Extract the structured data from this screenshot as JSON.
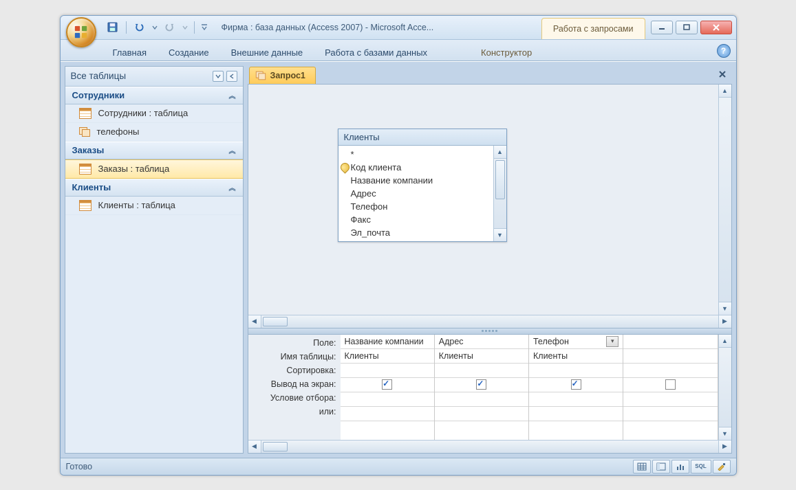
{
  "titlebar": {
    "app_title": "Фирма : база данных (Access 2007)  -  Microsoft Acce...",
    "context_tab": "Работа с запросами"
  },
  "ribbon": {
    "tabs": [
      "Главная",
      "Создание",
      "Внешние данные",
      "Работа с базами данных"
    ],
    "context": "Конструктор"
  },
  "nav": {
    "header": "Все таблицы",
    "groups": [
      {
        "title": "Сотрудники",
        "items": [
          {
            "label": "Сотрудники : таблица",
            "icon": "table",
            "selected": false
          },
          {
            "label": "телефоны",
            "icon": "query",
            "selected": false
          }
        ]
      },
      {
        "title": "Заказы",
        "items": [
          {
            "label": "Заказы : таблица",
            "icon": "table",
            "selected": true
          }
        ]
      },
      {
        "title": "Клиенты",
        "items": [
          {
            "label": "Клиенты : таблица",
            "icon": "table",
            "selected": false
          }
        ]
      }
    ]
  },
  "document": {
    "tab_label": "Запрос1"
  },
  "tablebox": {
    "title": "Клиенты",
    "fields": [
      {
        "name": "*",
        "key": false
      },
      {
        "name": "Код клиента",
        "key": true
      },
      {
        "name": "Название компании",
        "key": false
      },
      {
        "name": "Адрес",
        "key": false
      },
      {
        "name": "Телефон",
        "key": false
      },
      {
        "name": "Факс",
        "key": false
      },
      {
        "name": "Эл_почта",
        "key": false
      }
    ]
  },
  "grid": {
    "rows": [
      "Поле:",
      "Имя таблицы:",
      "Сортировка:",
      "Вывод на экран:",
      "Условие отбора:",
      "или:"
    ],
    "cols": [
      {
        "field": "Название компании",
        "table": "Клиенты",
        "show": true
      },
      {
        "field": "Адрес",
        "table": "Клиенты",
        "show": true
      },
      {
        "field": "Телефон",
        "table": "Клиенты",
        "show": true,
        "dropdown": true
      }
    ]
  },
  "status": {
    "text": "Готово",
    "sql_label": "SQL"
  }
}
